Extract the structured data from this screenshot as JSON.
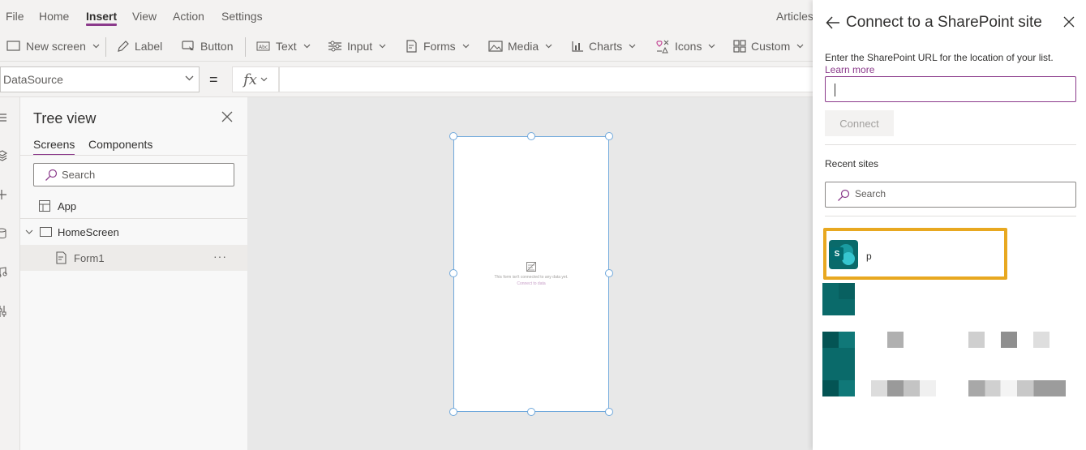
{
  "menu": {
    "items": [
      {
        "label": "File"
      },
      {
        "label": "Home"
      },
      {
        "label": "Insert"
      },
      {
        "label": "View"
      },
      {
        "label": "Action"
      },
      {
        "label": "Settings"
      }
    ],
    "active": "Insert",
    "app_title": "Articles"
  },
  "ribbon": {
    "new_screen": "New screen",
    "label": "Label",
    "button": "Button",
    "text": "Text",
    "input": "Input",
    "forms": "Forms",
    "media": "Media",
    "charts": "Charts",
    "icons": "Icons",
    "custom": "Custom"
  },
  "formula_bar": {
    "property": "DataSource",
    "equals": "=",
    "fx": "fx",
    "value": ""
  },
  "tree": {
    "title": "Tree view",
    "tabs": [
      {
        "label": "Screens"
      },
      {
        "label": "Components"
      }
    ],
    "search_placeholder": "Search",
    "items": [
      {
        "label": "App"
      },
      {
        "label": "HomeScreen"
      },
      {
        "label": "Form1"
      }
    ],
    "more": "···"
  },
  "canvas": {
    "form_message": "This form isn't connected to any data yet.",
    "form_link": "Connect to data"
  },
  "panel": {
    "title": "Connect to a SharePoint site",
    "url_hint": "Enter the SharePoint URL for the location of your list.",
    "learn_more": "Learn more",
    "url_value": "",
    "connect": "Connect",
    "recent_title": "Recent sites",
    "search_placeholder": "Search",
    "sites": [
      {
        "name": "p"
      }
    ]
  },
  "colors": {
    "accent": "#8b3a8b",
    "highlight": "#e8a820",
    "sharepoint": "#036c70"
  }
}
